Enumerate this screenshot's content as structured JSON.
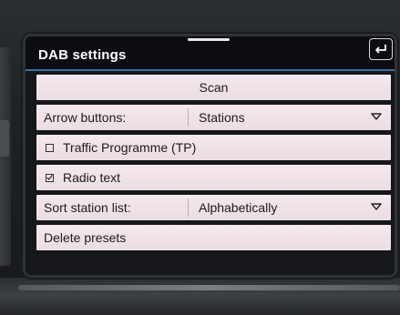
{
  "header": {
    "title": "DAB settings",
    "back_icon": "back-return-icon"
  },
  "menu": {
    "scan_label": "Scan",
    "arrow_buttons": {
      "label": "Arrow buttons:",
      "value": "Stations"
    },
    "traffic_programme": {
      "label": "Traffic Programme (TP)",
      "checked": false
    },
    "radio_text": {
      "label": "Radio text",
      "checked": true
    },
    "sort_station_list": {
      "label": "Sort station list:",
      "value": "Alphabetically"
    },
    "delete_presets_label": "Delete presets"
  },
  "colors": {
    "row_bg": "#f1e6ea",
    "header_bg": "#0c0d10",
    "accent_rule": "#3a6ea5"
  }
}
